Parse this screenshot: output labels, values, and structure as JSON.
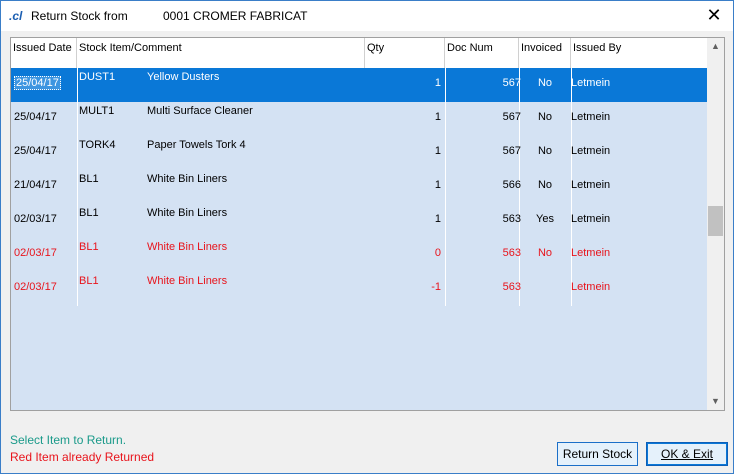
{
  "title": {
    "label": "Return Stock from",
    "customer": "0001 CROMER FABRICAT",
    "icon": "app-logo-icon",
    "logo_text": ".cl"
  },
  "grid": {
    "columns": [
      "Issued Date",
      "Stock Item/Comment",
      "Qty",
      "Doc Num",
      "Invoiced",
      "Issued By"
    ],
    "rows": [
      {
        "date": "25/04/17",
        "code": "DUST1",
        "desc": "Yellow Dusters",
        "qty": "1",
        "doc": "567",
        "invoiced": "No",
        "by": "Letmein",
        "returned": false,
        "selected": true
      },
      {
        "date": "25/04/17",
        "code": "MULT1",
        "desc": "Multi Surface Cleaner",
        "qty": "1",
        "doc": "567",
        "invoiced": "No",
        "by": "Letmein",
        "returned": false,
        "selected": false
      },
      {
        "date": "25/04/17",
        "code": "TORK4",
        "desc": "Paper Towels Tork 4",
        "qty": "1",
        "doc": "567",
        "invoiced": "No",
        "by": "Letmein",
        "returned": false,
        "selected": false
      },
      {
        "date": "21/04/17",
        "code": "BL1",
        "desc": "White Bin Liners",
        "qty": "1",
        "doc": "566",
        "invoiced": "No",
        "by": "Letmein",
        "returned": false,
        "selected": false
      },
      {
        "date": "02/03/17",
        "code": "BL1",
        "desc": "White Bin Liners",
        "qty": "1",
        "doc": "563",
        "invoiced": "Yes",
        "by": "Letmein",
        "returned": false,
        "selected": false
      },
      {
        "date": "02/03/17",
        "code": "BL1",
        "desc": "White Bin Liners",
        "qty": "0",
        "doc": "563",
        "invoiced": "No",
        "by": "Letmein",
        "returned": true,
        "selected": false
      },
      {
        "date": "02/03/17",
        "code": "BL1",
        "desc": "White Bin Liners",
        "qty": "-1",
        "doc": "563",
        "invoiced": "",
        "by": "Letmein",
        "returned": true,
        "selected": false
      }
    ]
  },
  "footer": {
    "hint": "Select Item to Return.",
    "legend": "Red Item already Returned",
    "return_button": "Return Stock",
    "ok_button": "OK & Exit"
  },
  "colors": {
    "hint": "#1a9a8a",
    "returned": "#e8141c",
    "selected_row": "#0a78d7",
    "grid_bg": "#d4e2f3"
  }
}
